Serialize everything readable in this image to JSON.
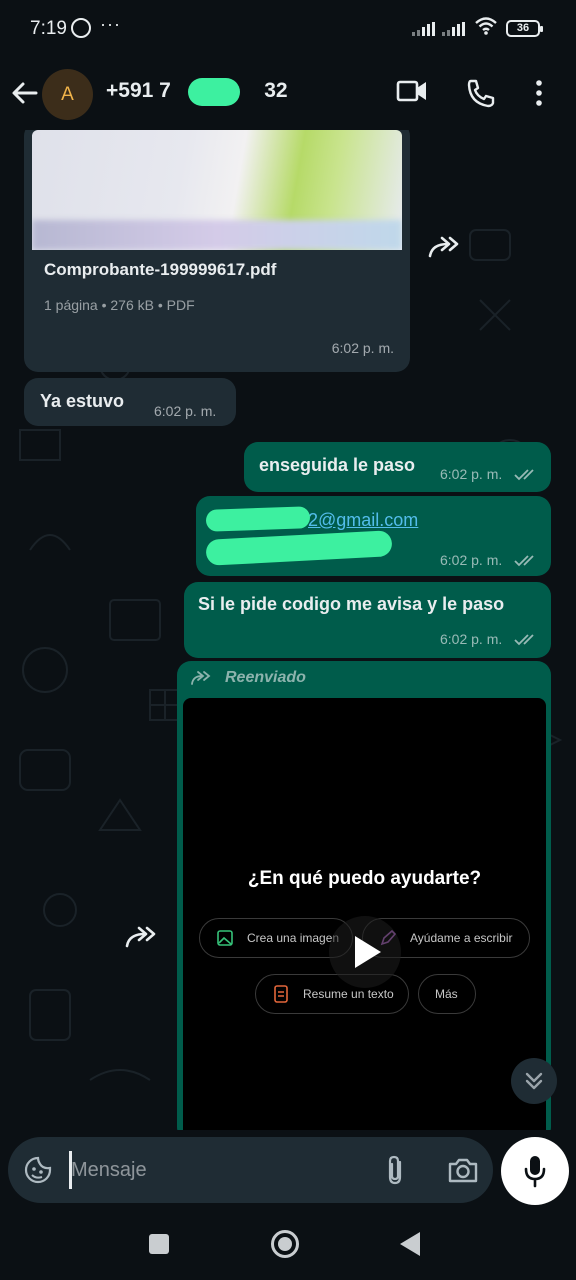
{
  "status_bar": {
    "time": "7:19",
    "more": "···",
    "battery": "36"
  },
  "header": {
    "avatar_letter": "A",
    "contact_number": "+591 7        32"
  },
  "messages": {
    "pdf": {
      "filename": "Comprobante-199999617.pdf",
      "meta": "1 página • 276 kB • PDF",
      "time": "6:02 p. m."
    },
    "ya_estuvo": {
      "text": "Ya estuvo",
      "time": "6:02 p. m."
    },
    "enseguida": {
      "text": "enseguida le paso",
      "time": "6:02 p. m."
    },
    "email": {
      "text": "2@gmail.com",
      "time": "6:02 p. m."
    },
    "codigo": {
      "text": "Si le pide codigo me avisa y le paso",
      "time": "6:02 p. m."
    },
    "forwarded_video": {
      "label": "Reenviado",
      "title": "¿En qué puedo ayudarte?",
      "chips": [
        "Crea una imagen",
        "Ayúdame a escribir",
        "Resume un texto",
        "Más"
      ]
    }
  },
  "input": {
    "placeholder": "Mensaje"
  },
  "colors": {
    "background": "#0b1014",
    "incoming_bubble": "#1f2c34",
    "outgoing_bubble": "#005c4b",
    "link": "#53bdeb",
    "redaction": "#3df0a0"
  }
}
